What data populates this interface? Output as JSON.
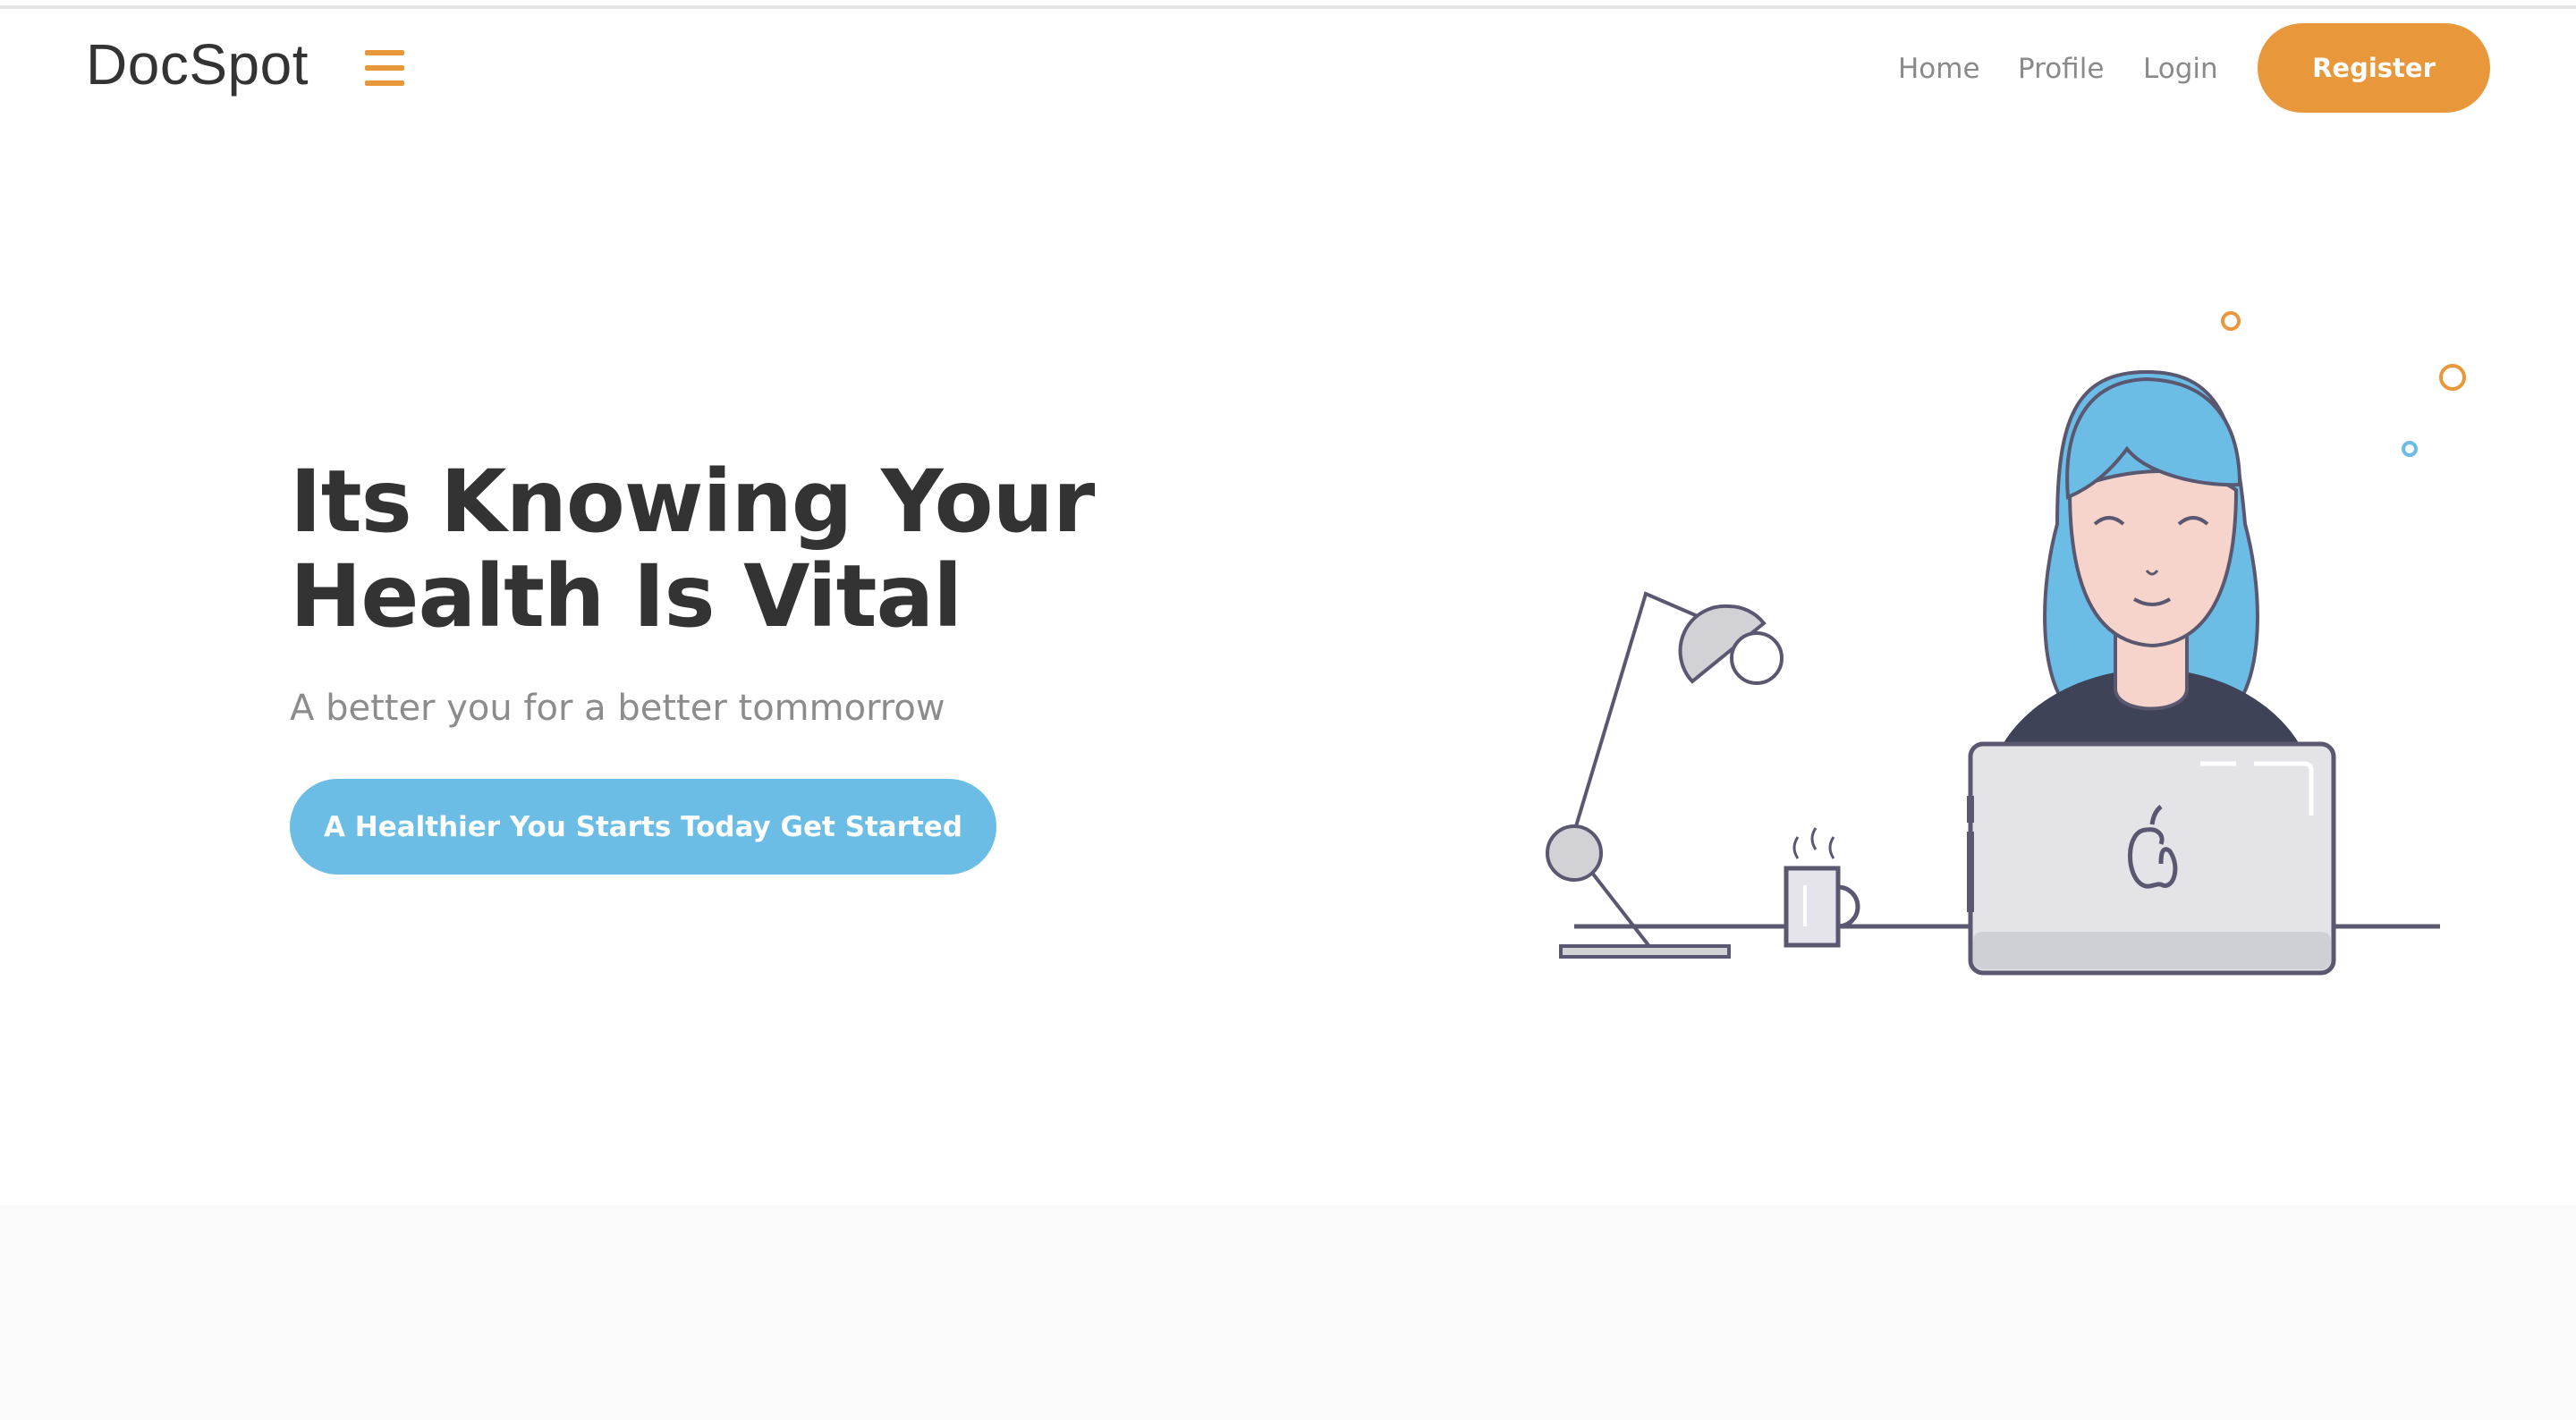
{
  "brand": {
    "name": "DocSpot"
  },
  "nav": {
    "links": [
      "Home",
      "Profile",
      "Login"
    ],
    "register_label": "Register"
  },
  "hero": {
    "title_line1": "Its Knowing Your",
    "title_line2": "Health Is Vital",
    "subtitle": "A better you for a better tommorrow",
    "cta_label": "A Healthier You Starts Today Get Started"
  },
  "colors": {
    "accent_orange": "#e8973a",
    "accent_blue": "#6bbde6",
    "text_dark": "#333333",
    "text_muted": "#8c8c8c"
  },
  "icons": [
    "hamburger-menu-icon",
    "apple-logo-icon"
  ]
}
